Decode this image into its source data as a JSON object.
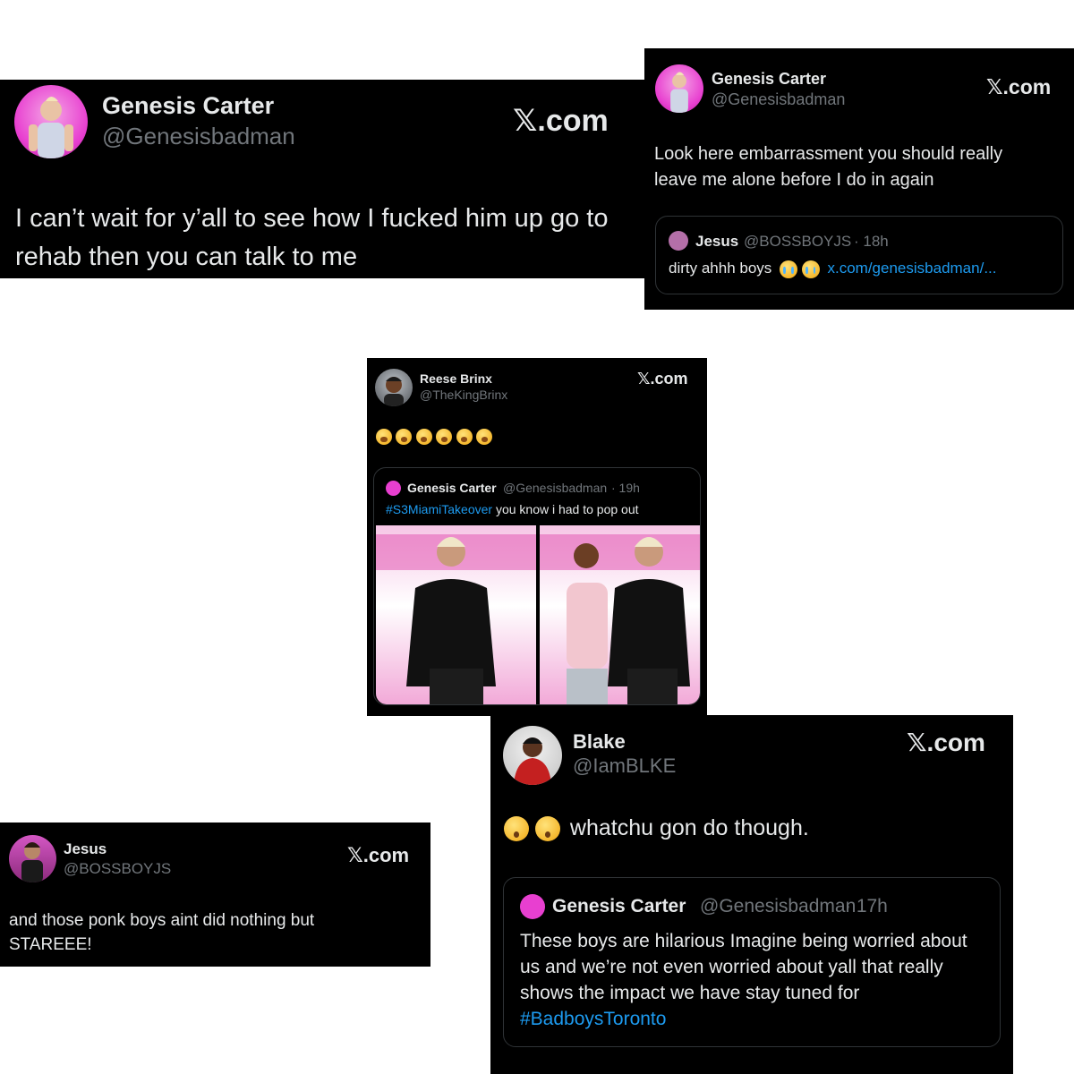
{
  "cards": {
    "c1": {
      "name": "Genesis Carter",
      "handle": "@Genesisbadman",
      "site": "𝕏.com",
      "text": "I can’t wait for y’all to see how I fucked him up go to rehab then you can talk to me"
    },
    "c2": {
      "name": "Genesis Carter",
      "handle": "@Genesisbadman",
      "site": "𝕏.com",
      "text": "Look here embarrassment you should really leave me alone before I do in again",
      "quote": {
        "name": "Jesus",
        "handle": "@BOSSBOYJS",
        "time": "· 18h",
        "text": "dirty ahhh boys",
        "link": "x.com/genesisbadman/..."
      }
    },
    "c3": {
      "name": "Reese Brinx",
      "handle": "@TheKingBrinx",
      "site": "𝕏.com",
      "quote": {
        "name": "Genesis Carter",
        "handle": "@Genesisbadman",
        "time": "· 19h",
        "hashtag": "#S3MiamiTakeover",
        "text": "you know i had to pop out"
      }
    },
    "c4": {
      "name": "Jesus",
      "handle": "@BOSSBOYJS",
      "site": "𝕏.com",
      "text": "and those ponk boys aint did nothing but STAREEE!"
    },
    "c5": {
      "name": "Blake",
      "handle": "@IamBLKE",
      "site": "𝕏.com",
      "text": "whatchu gon do though.",
      "quote": {
        "name": "Genesis Carter",
        "handle": "@Genesisbadman",
        "time": "· 17h",
        "text": "These boys are hilarious Imagine being worried about us and we’re not even worried about yall that really shows the impact we have stay tuned for",
        "hashtag": "#BadboysToronto"
      }
    }
  },
  "colors": {
    "card_bg": "#000000",
    "text": "#e7e9ea",
    "muted": "#71767b",
    "link": "#1d9bf0",
    "border": "#2f3336",
    "avatar_pink": "#e83fd0"
  },
  "icons": {
    "emoji_cry": "loudly-crying-face",
    "emoji_yawn": "yawning-face",
    "emoji_shock": "astonished-face"
  }
}
